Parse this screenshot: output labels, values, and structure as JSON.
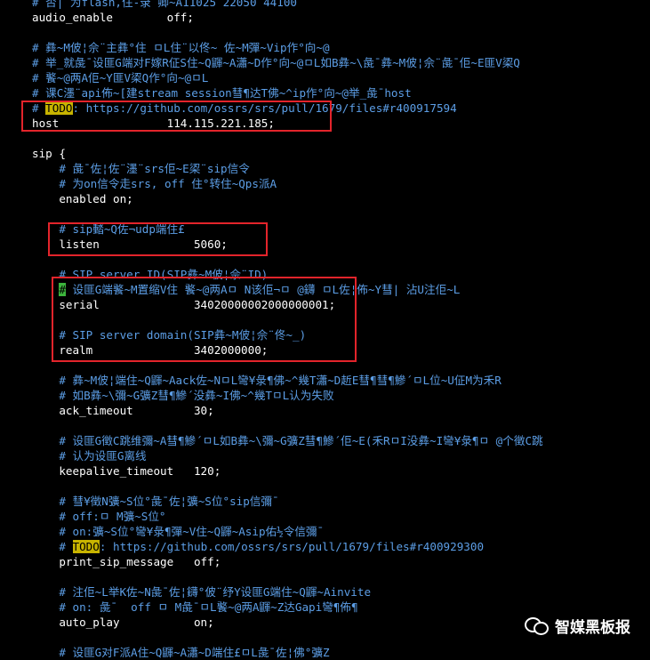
{
  "terminal": {
    "lines": [
      {
        "t": "# 否| 为flash,住-录 卿~A11025 22050 44100",
        "k": "cm"
      },
      {
        "t": "audio_enable        off;",
        "k": "kw"
      },
      {
        "t": "",
        "k": "kw"
      },
      {
        "t": "# 彝~M佊¦佘¨主彝°住 ㅁL住¨以佟~ 佐~M彈~Vip作°向~@",
        "k": "cm"
      },
      {
        "t": "# 举_就彘¯设匪G端对F嫁R佂S住~Q鼲~A瀟~D作°向~@ㅁL如B彝~\\彘¯彝~M佊¦佘¨彘¯佢~E匪V鿄Q",
        "k": "cm"
      },
      {
        "t": "# 饏~@两A佢~Y匪V鿄Q作°向~@ㅁL",
        "k": "cm"
      },
      {
        "t": "# 课C濹¨api佈~[建stream session彗¶达T佛~^ip作°向~@举_彘¯host",
        "k": "cm"
      },
      {
        "t": "# TODO: https://github.com/ossrs/srs/pull/1679/files#r400917594",
        "k": "cm",
        "todo": true
      },
      {
        "t": "host                114.115.221.185;",
        "k": "kw"
      },
      {
        "t": "",
        "k": "kw"
      },
      {
        "t": "sip {",
        "k": "kw"
      },
      {
        "t": "    # 彘¯佐¦佐¨濹¨srs佢~E鿄¨sip信令",
        "k": "cm"
      },
      {
        "t": "    # 为on信令走srs, off 住°转住~Qps派A",
        "k": "cm"
      },
      {
        "t": "    enabled on;",
        "k": "kw"
      },
      {
        "t": "",
        "k": "kw"
      },
      {
        "t": "    # sip濌~Q佐¬udp端住£",
        "k": "cm"
      },
      {
        "t": "    listen              5060;",
        "k": "kw"
      },
      {
        "t": "",
        "k": "kw"
      },
      {
        "t": "    # SIP server ID(SIP彝~M佊¦佘¨ID).",
        "k": "cm"
      },
      {
        "t": "    # 设匪G端饏~M置缩V住 饏~@两Aㅁ N该佢¬ㅁ @鑮 ㅁL佐¦佈~Y彗| 沾U注佢~L",
        "k": "cm",
        "cursor": true
      },
      {
        "t": "    serial              34020000002000000001;",
        "k": "kw"
      },
      {
        "t": "",
        "k": "kw"
      },
      {
        "t": "    # SIP server domain(SIP彝~M佊¦佘¨佟~_)",
        "k": "cm"
      },
      {
        "t": "    realm               3402000000;",
        "k": "kw"
      },
      {
        "t": "",
        "k": "kw"
      },
      {
        "t": "    # 彝~M佊¦端住~Q鼲~Aack佐~NㅁL彎¥彔¶佛~^幾T瀟~D赾E彗¶彗¶鰺´ㅁL位~U佂M为禾R",
        "k": "cm"
      },
      {
        "t": "    # 如B彝~\\彌~G彍Z彗¶鰺´没彝~I佛~^幾TㅁL认为失败",
        "k": "cm"
      },
      {
        "t": "    ack_timeout         30;",
        "k": "kw"
      },
      {
        "t": "",
        "k": "kw"
      },
      {
        "t": "    # 设匪G徵C跳维彌~A彗¶鰺´ㅁL如B彝~\\彌~G彍Z彗¶鰺´佢~E(禾RㅁI没彝~I彎¥彔¶ㅁ @个徵C跳",
        "k": "cm"
      },
      {
        "t": "    # 认为设匪G离线",
        "k": "cm"
      },
      {
        "t": "    keepalive_timeout   120;",
        "k": "kw"
      },
      {
        "t": "",
        "k": "kw"
      },
      {
        "t": "    # 彗¥徵N彍~S位°彘¯佐¦彍~S位°sip信彌¯",
        "k": "cm"
      },
      {
        "t": "    # off:ㅁ M彍~S位°",
        "k": "cm"
      },
      {
        "t": "    # on:彍~S位°彎¥彔¶彈~V住~Q鼲~Asip佑½令信彌¯",
        "k": "cm"
      },
      {
        "t": "    # TODO: https://github.com/ossrs/srs/pull/1679/files#r400929300",
        "k": "cm",
        "todo": true
      },
      {
        "t": "    print_sip_message   off;",
        "k": "kw"
      },
      {
        "t": "",
        "k": "kw"
      },
      {
        "t": "    # 注佢~L举K佐~N彘¯佐¦鑮°佊¨纾Y设匪G端住~Q鼲~Ainvite",
        "k": "cm"
      },
      {
        "t": "    # on: 彘¯  off ㅁ M彘¯ㅁL饏~@两A鼲~Z达Gapi彎¶佈¶",
        "k": "cm"
      },
      {
        "t": "    auto_play           on;",
        "k": "kw"
      },
      {
        "t": "",
        "k": "kw"
      },
      {
        "t": "    # 设匪G对F派A住~Q鼲~A瀟~D端住£ㅁL彘¯佐¦佛°彍Z",
        "k": "cm"
      }
    ]
  },
  "watermark": {
    "text": "智媒黑板报",
    "logo_icon": "wechat-bubbles-icon"
  },
  "colors": {
    "background": "#000000",
    "keyword": "#ffffff",
    "comment": "#5c9ee6",
    "todo_highlight": "#c8b400",
    "annotation_box": "#e3242b",
    "cursor": "#3cb43c"
  }
}
